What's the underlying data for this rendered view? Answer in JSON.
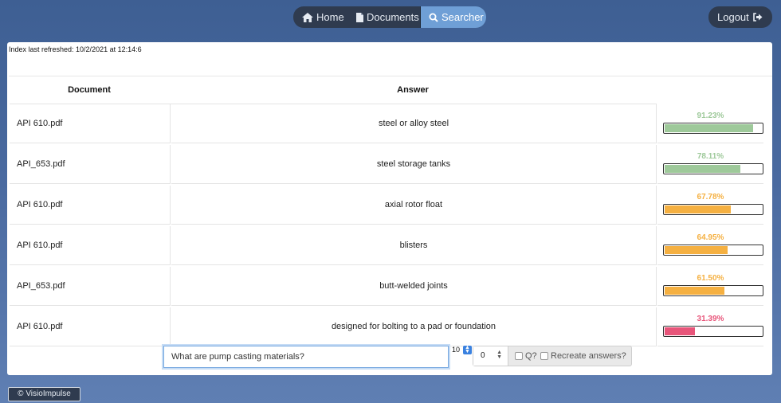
{
  "nav": {
    "home_label": "Home",
    "documents_label": "Documents",
    "searcher_label": "Searcher",
    "logout_label": "Logout"
  },
  "index_refresh": "Index last refreshed: 10/2/2021 at 12:14:6",
  "table": {
    "headers": [
      "Document",
      "Answer"
    ],
    "rows": [
      {
        "document": "API 610.pdf",
        "answer": "steel or alloy steel",
        "score_text": "91.23%",
        "score": 0.9123,
        "color": "#9ec99a"
      },
      {
        "document": "API_653.pdf",
        "answer": "steel storage tanks",
        "score_text": "78.11%",
        "score": 0.7811,
        "color": "#9ec99a"
      },
      {
        "document": "API 610.pdf",
        "answer": "axial rotor float",
        "score_text": "67.78%",
        "score": 0.6778,
        "color": "#f5b041"
      },
      {
        "document": "API 610.pdf",
        "answer": "blisters",
        "score_text": "64.95%",
        "score": 0.6495,
        "color": "#f5b041"
      },
      {
        "document": "API_653.pdf",
        "answer": "butt-welded joints",
        "score_text": "61.50%",
        "score": 0.615,
        "color": "#f5b041"
      },
      {
        "document": "API 610.pdf",
        "answer": "designed for bolting to a pad or foundation",
        "score_text": "31.39%",
        "score": 0.3139,
        "color": "#e8557a"
      }
    ]
  },
  "search": {
    "query": "What are pump casting materials?",
    "top_k": "10",
    "offset_value": "0",
    "q_label": "Q?",
    "recreate_label": "Recreate answers?"
  },
  "footer": {
    "brand": "© VisioImpulse"
  }
}
